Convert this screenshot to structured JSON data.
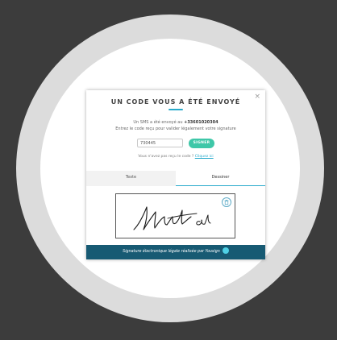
{
  "modal": {
    "title": "UN CODE VOUS A ÉTÉ ENVOYÉ",
    "close_label": "×",
    "sms_sent_prefix": "Un SMS a été envoyé au ",
    "phone_number": "+33601020304",
    "instruction": "Entrez le code reçu pour valider légalement votre signature",
    "code_value": "730445",
    "sign_button_label": "SIGNER",
    "resend_prefix": "Vous n'avez pas reçu le code ? ",
    "resend_link": "Cliquez ici",
    "tabs": [
      {
        "label": "Texte"
      },
      {
        "label": "Dessiner"
      }
    ],
    "footer_text": "Signature électronique légale réalisée par Yousign"
  },
  "colors": {
    "accent": "#27aacb",
    "sign_button": "#3ec7a8",
    "footer_bg": "#175a73",
    "page_bg": "#3c3c3c"
  },
  "icons": {
    "close": "close-icon",
    "trash": "trash-icon",
    "logo": "yousign-logo-icon"
  }
}
